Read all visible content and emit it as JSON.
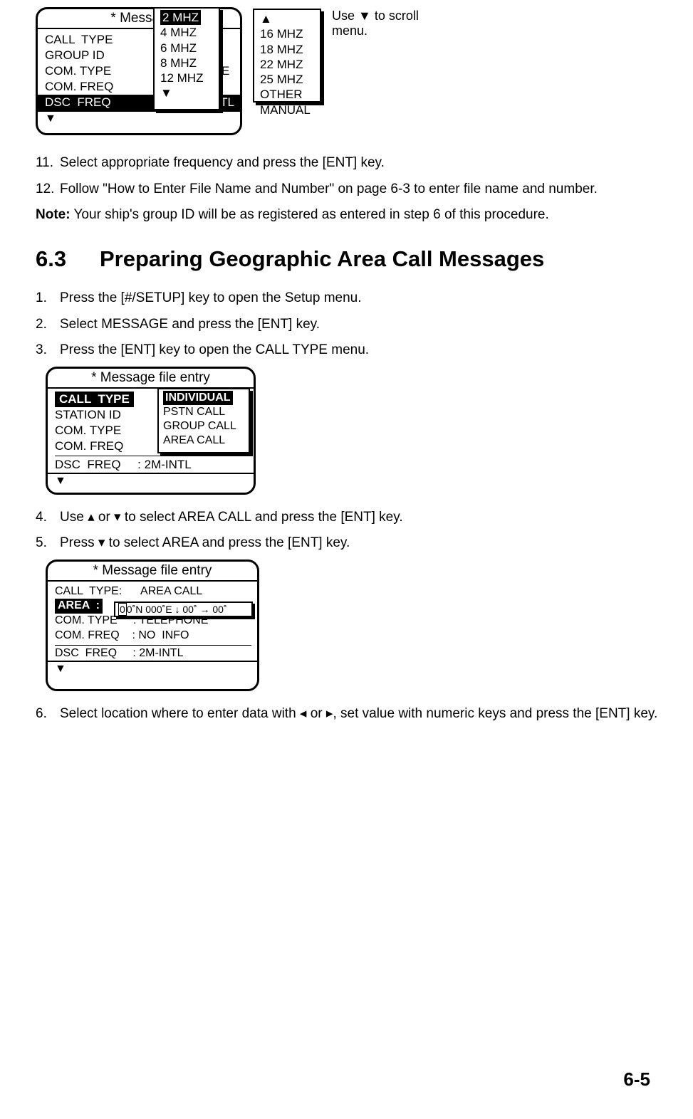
{
  "top": {
    "panel1": {
      "title": "* Messag",
      "r1": "CALL  TYPE",
      "r2": "GROUP ID",
      "r3": "COM. TYPE",
      "r4": "COM. FREQ",
      "r5a": "DSC  FREQ",
      "r5b": "TL",
      "partial_e": "E",
      "footer": "▼"
    },
    "popup1": {
      "sel": "2 MHZ",
      "i2": "4 MHZ",
      "i3": "6 MHZ",
      "i4": "8 MHZ",
      "i5": "12 MHZ",
      "footer": "▼"
    },
    "popup2": {
      "top": "▲",
      "i1": "16 MHZ",
      "i2": "18 MHZ",
      "i3": "22 MHZ",
      "i4": "25 MHZ",
      "i5": "OTHER",
      "i6": "MANUAL"
    },
    "side": "Use ▼ to scroll menu."
  },
  "steps_a": {
    "s11": "Select appropriate frequency and press the [ENT] key.",
    "s12": "Follow \"How to Enter File Name and Number\" on page 6-3 to enter file name and number."
  },
  "note": "Your ship's group ID will be as registered as entered in step 6 of this procedure.",
  "heading": {
    "num": "6.3",
    "text": "Preparing Geographic Area Call Messages"
  },
  "steps_b": {
    "s1": "Press the [#/SETUP] key to open the Setup menu.",
    "s2": "Select MESSAGE and press the [ENT] key.",
    "s3": "Press the [ENT] key to open the CALL TYPE menu."
  },
  "panel2": {
    "title": "* Message file entry",
    "r1": "CALL  TYPE",
    "r2": "STATION ID",
    "r3": "COM. TYPE",
    "r4": "COM. FREQ",
    "r5": "DSC  FREQ     : 2M-INTL",
    "footer": "▼",
    "popup": {
      "sel": "INDIVIDUAL",
      "i2": "PSTN CALL",
      "i3": "GROUP CALL",
      "i4": "AREA CALL"
    }
  },
  "steps_c": {
    "s4": "Use ▴ or ▾ to select AREA CALL and press the [ENT] key.",
    "s5": "Press ▾ to select AREA and press the [ENT] key."
  },
  "panel3": {
    "title": "* Message file entry",
    "r1": "CALL  TYPE:      AREA CALL",
    "r2a": "AREA  :",
    "area_val": "00˚N  000˚E  ↓ 00˚  → 00˚",
    "area_cursor": "0",
    "r3": "COM. TYPE     : TELEPHONE",
    "r4": "COM. FREQ    : NO  INFO",
    "r5": "DSC  FREQ     : 2M-INTL",
    "footer": "▼"
  },
  "steps_d": {
    "s6": "Select location where to enter data with ◂ or ▸, set value with numeric keys and press the [ENT] key."
  },
  "page": "6-5"
}
